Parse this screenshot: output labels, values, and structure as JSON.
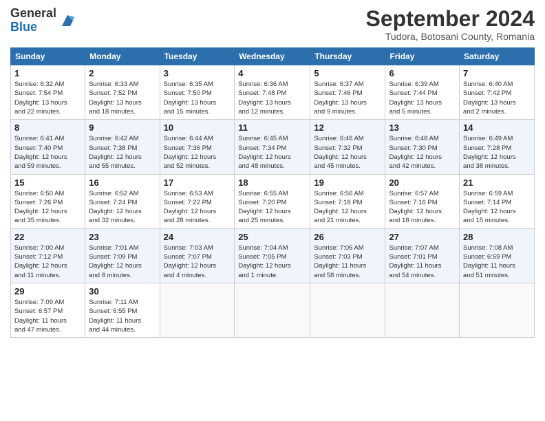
{
  "header": {
    "logo_general": "General",
    "logo_blue": "Blue",
    "month_title": "September 2024",
    "location": "Tudora, Botosani County, Romania"
  },
  "calendar": {
    "days_of_week": [
      "Sunday",
      "Monday",
      "Tuesday",
      "Wednesday",
      "Thursday",
      "Friday",
      "Saturday"
    ],
    "weeks": [
      [
        {
          "day": "1",
          "info": "Sunrise: 6:32 AM\nSunset: 7:54 PM\nDaylight: 13 hours\nand 22 minutes."
        },
        {
          "day": "2",
          "info": "Sunrise: 6:33 AM\nSunset: 7:52 PM\nDaylight: 13 hours\nand 18 minutes."
        },
        {
          "day": "3",
          "info": "Sunrise: 6:35 AM\nSunset: 7:50 PM\nDaylight: 13 hours\nand 15 minutes."
        },
        {
          "day": "4",
          "info": "Sunrise: 6:36 AM\nSunset: 7:48 PM\nDaylight: 13 hours\nand 12 minutes."
        },
        {
          "day": "5",
          "info": "Sunrise: 6:37 AM\nSunset: 7:46 PM\nDaylight: 13 hours\nand 9 minutes."
        },
        {
          "day": "6",
          "info": "Sunrise: 6:39 AM\nSunset: 7:44 PM\nDaylight: 13 hours\nand 5 minutes."
        },
        {
          "day": "7",
          "info": "Sunrise: 6:40 AM\nSunset: 7:42 PM\nDaylight: 13 hours\nand 2 minutes."
        }
      ],
      [
        {
          "day": "8",
          "info": "Sunrise: 6:41 AM\nSunset: 7:40 PM\nDaylight: 12 hours\nand 59 minutes."
        },
        {
          "day": "9",
          "info": "Sunrise: 6:42 AM\nSunset: 7:38 PM\nDaylight: 12 hours\nand 55 minutes."
        },
        {
          "day": "10",
          "info": "Sunrise: 6:44 AM\nSunset: 7:36 PM\nDaylight: 12 hours\nand 52 minutes."
        },
        {
          "day": "11",
          "info": "Sunrise: 6:45 AM\nSunset: 7:34 PM\nDaylight: 12 hours\nand 48 minutes."
        },
        {
          "day": "12",
          "info": "Sunrise: 6:46 AM\nSunset: 7:32 PM\nDaylight: 12 hours\nand 45 minutes."
        },
        {
          "day": "13",
          "info": "Sunrise: 6:48 AM\nSunset: 7:30 PM\nDaylight: 12 hours\nand 42 minutes."
        },
        {
          "day": "14",
          "info": "Sunrise: 6:49 AM\nSunset: 7:28 PM\nDaylight: 12 hours\nand 38 minutes."
        }
      ],
      [
        {
          "day": "15",
          "info": "Sunrise: 6:50 AM\nSunset: 7:26 PM\nDaylight: 12 hours\nand 35 minutes."
        },
        {
          "day": "16",
          "info": "Sunrise: 6:52 AM\nSunset: 7:24 PM\nDaylight: 12 hours\nand 32 minutes."
        },
        {
          "day": "17",
          "info": "Sunrise: 6:53 AM\nSunset: 7:22 PM\nDaylight: 12 hours\nand 28 minutes."
        },
        {
          "day": "18",
          "info": "Sunrise: 6:55 AM\nSunset: 7:20 PM\nDaylight: 12 hours\nand 25 minutes."
        },
        {
          "day": "19",
          "info": "Sunrise: 6:56 AM\nSunset: 7:18 PM\nDaylight: 12 hours\nand 21 minutes."
        },
        {
          "day": "20",
          "info": "Sunrise: 6:57 AM\nSunset: 7:16 PM\nDaylight: 12 hours\nand 18 minutes."
        },
        {
          "day": "21",
          "info": "Sunrise: 6:59 AM\nSunset: 7:14 PM\nDaylight: 12 hours\nand 15 minutes."
        }
      ],
      [
        {
          "day": "22",
          "info": "Sunrise: 7:00 AM\nSunset: 7:12 PM\nDaylight: 12 hours\nand 11 minutes."
        },
        {
          "day": "23",
          "info": "Sunrise: 7:01 AM\nSunset: 7:09 PM\nDaylight: 12 hours\nand 8 minutes."
        },
        {
          "day": "24",
          "info": "Sunrise: 7:03 AM\nSunset: 7:07 PM\nDaylight: 12 hours\nand 4 minutes."
        },
        {
          "day": "25",
          "info": "Sunrise: 7:04 AM\nSunset: 7:05 PM\nDaylight: 12 hours\nand 1 minute."
        },
        {
          "day": "26",
          "info": "Sunrise: 7:05 AM\nSunset: 7:03 PM\nDaylight: 11 hours\nand 58 minutes."
        },
        {
          "day": "27",
          "info": "Sunrise: 7:07 AM\nSunset: 7:01 PM\nDaylight: 11 hours\nand 54 minutes."
        },
        {
          "day": "28",
          "info": "Sunrise: 7:08 AM\nSunset: 6:59 PM\nDaylight: 11 hours\nand 51 minutes."
        }
      ],
      [
        {
          "day": "29",
          "info": "Sunrise: 7:09 AM\nSunset: 6:57 PM\nDaylight: 11 hours\nand 47 minutes."
        },
        {
          "day": "30",
          "info": "Sunrise: 7:11 AM\nSunset: 6:55 PM\nDaylight: 11 hours\nand 44 minutes."
        },
        null,
        null,
        null,
        null,
        null
      ]
    ]
  }
}
